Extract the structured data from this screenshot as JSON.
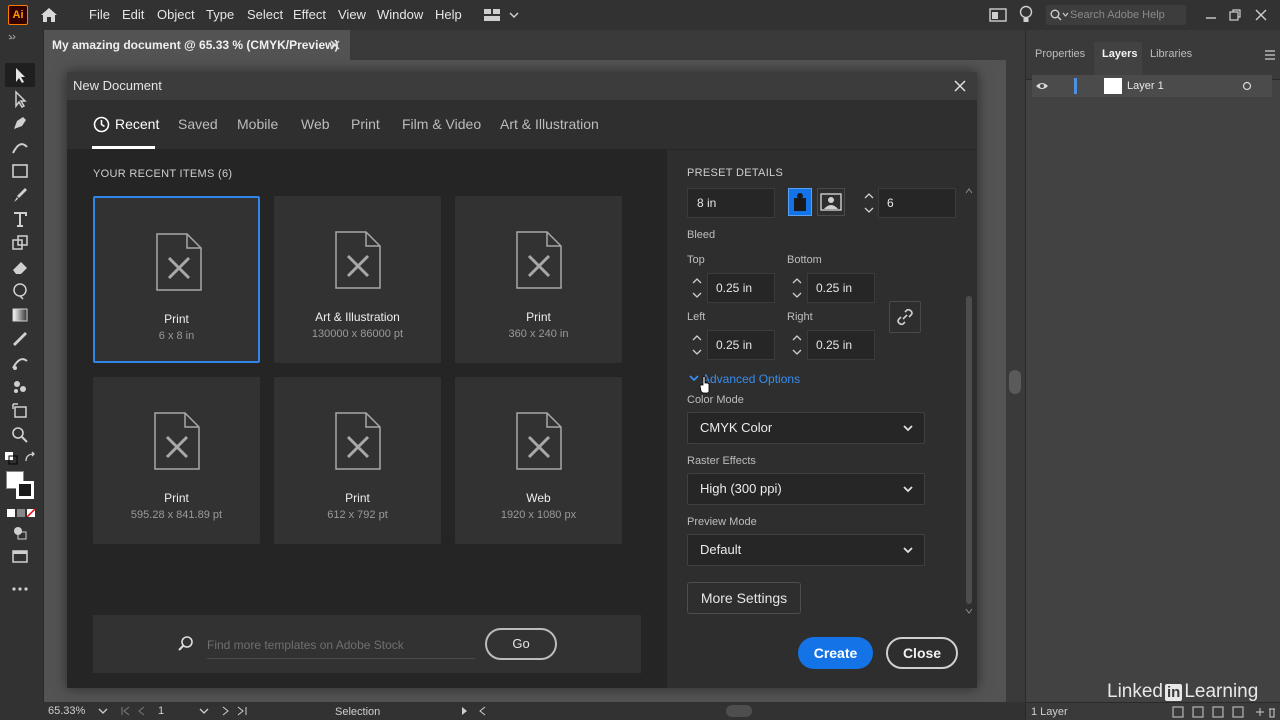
{
  "menubar": {
    "app_logo": "Ai",
    "items": [
      "File",
      "Edit",
      "Object",
      "Type",
      "Select",
      "Effect",
      "View",
      "Window",
      "Help"
    ],
    "search_placeholder": "Search Adobe Help"
  },
  "document_tab": {
    "title": "My amazing document @ 65.33 % (CMYK/Preview)"
  },
  "panel": {
    "tabs": [
      "Properties",
      "Layers",
      "Libraries"
    ],
    "active_tab": "Layers",
    "layer_name": "Layer 1",
    "layer_count": "1 Layer"
  },
  "status": {
    "zoom": "65.33%",
    "artboard": "1",
    "tool": "Selection"
  },
  "dialog": {
    "title": "New Document",
    "tabs": [
      "Recent",
      "Saved",
      "Mobile",
      "Web",
      "Print",
      "Film & Video",
      "Art & Illustration"
    ],
    "active_tab": "Recent",
    "recent_label": "YOUR RECENT ITEMS",
    "recent_count": "(6)",
    "recent_items": [
      {
        "name": "Print",
        "size": "6 x 8 in"
      },
      {
        "name": "Art & Illustration",
        "size": "130000 x 86000 pt"
      },
      {
        "name": "Print",
        "size": "360 x 240 in"
      },
      {
        "name": "Print",
        "size": "595.28 x 841.89 pt"
      },
      {
        "name": "Print",
        "size": "612 x 792 pt"
      },
      {
        "name": "Web",
        "size": "1920 x 1080 px"
      }
    ],
    "stock_placeholder": "Find more templates on Adobe Stock",
    "go_label": "Go",
    "preset": {
      "label": "PRESET DETAILS",
      "height_value": "8 in",
      "artboards_value": "6",
      "bleed_label": "Bleed",
      "top_label": "Top",
      "top_value": "0.25 in",
      "bottom_label": "Bottom",
      "bottom_value": "0.25 in",
      "left_label": "Left",
      "left_value": "0.25 in",
      "right_label": "Right",
      "right_value": "0.25 in",
      "advanced_label": "Advanced Options",
      "color_mode_label": "Color Mode",
      "color_mode_value": "CMYK Color",
      "raster_label": "Raster Effects",
      "raster_value": "High (300 ppi)",
      "preview_label": "Preview Mode",
      "preview_value": "Default",
      "more_settings": "More Settings",
      "create": "Create",
      "close": "Close"
    }
  },
  "watermark": {
    "left": "Linked",
    "in": "in",
    "right": "Learning"
  },
  "colors": {
    "accent": "#1473e6",
    "selection": "#2f86e8",
    "link": "#378ef0"
  }
}
